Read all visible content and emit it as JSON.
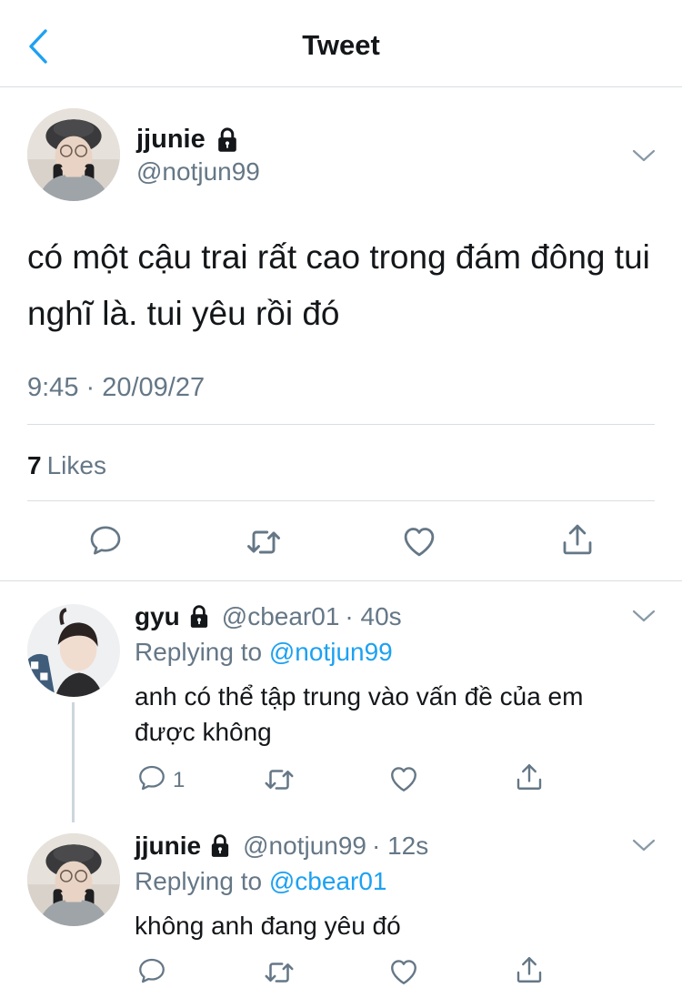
{
  "header": {
    "title": "Tweet"
  },
  "main_tweet": {
    "name": "jjunie",
    "handle": "@notjun99",
    "text": "có một cậu trai rất cao trong đám đông tui nghĩ là. tui yêu rồi đó",
    "timestamp": "9:45 · 20/09/27",
    "likes_count": "7",
    "likes_label": "Likes"
  },
  "replies": [
    {
      "name": "gyu",
      "handle": "@cbear01",
      "time": "· 40s",
      "replying_prefix": "Replying to",
      "replying_to": "@notjun99",
      "text": "anh có thể tập trung vào vấn đề của em được không",
      "reply_count": "1"
    },
    {
      "name": "jjunie",
      "handle": "@notjun99",
      "time": "· 12s",
      "replying_prefix": "Replying to",
      "replying_to": "@cbear01",
      "text": "không anh đang yêu đó"
    }
  ],
  "icons": {
    "back": "chevron-left-icon",
    "lock": "lock-icon",
    "more": "chevron-down-icon",
    "reply": "comment-icon",
    "retweet": "retweet-icon",
    "like": "heart-icon",
    "share": "share-icon"
  },
  "colors": {
    "accent": "#1da1f2",
    "secondary_text": "#657786",
    "divider": "#d9dee2",
    "icon": "#657786"
  }
}
